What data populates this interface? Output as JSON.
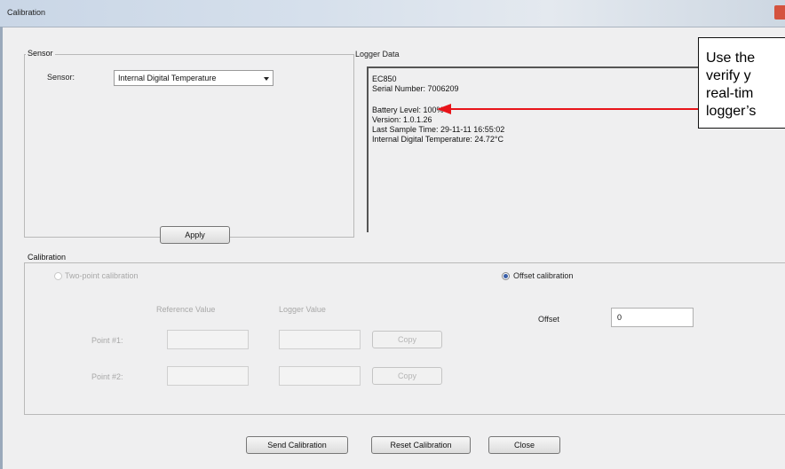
{
  "window": {
    "title": "Calibration"
  },
  "sensor_group": {
    "title": "Sensor",
    "sensor_label": "Sensor:",
    "sensor_value": "Internal Digital Temperature",
    "apply_label": "Apply"
  },
  "logger_group": {
    "title": "Logger Data",
    "lines": {
      "model": "EC850",
      "serial": "Serial Number: 7006209",
      "battery": "Battery Level: 100%",
      "version": "Version: 1.0.1.26",
      "last_sample": "Last Sample Time:  29-11-11 16:55:02",
      "temperature": "Internal Digital Temperature: 24.72°C"
    }
  },
  "calibration_group": {
    "title": "Calibration",
    "two_point_label": "Two-point calibration",
    "offset_mode_label": "Offset calibration",
    "reference_header": "Reference Value",
    "logger_header": "Logger Value",
    "point1_label": "Point #1:",
    "point2_label": "Point #2:",
    "copy_label": "Copy",
    "offset_label": "Offset",
    "offset_value": "0"
  },
  "footer": {
    "send_label": "Send Calibration",
    "reset_label": "Reset Calibration",
    "close_label": "Close"
  },
  "callout": {
    "line1": "Use the",
    "line2": "verify y",
    "line3": "real-tim",
    "line4": "logger’s"
  },
  "colors": {
    "arrow": "#e8141a",
    "radio_selected": "#3a5fa8",
    "close_button": "#d4533e"
  }
}
